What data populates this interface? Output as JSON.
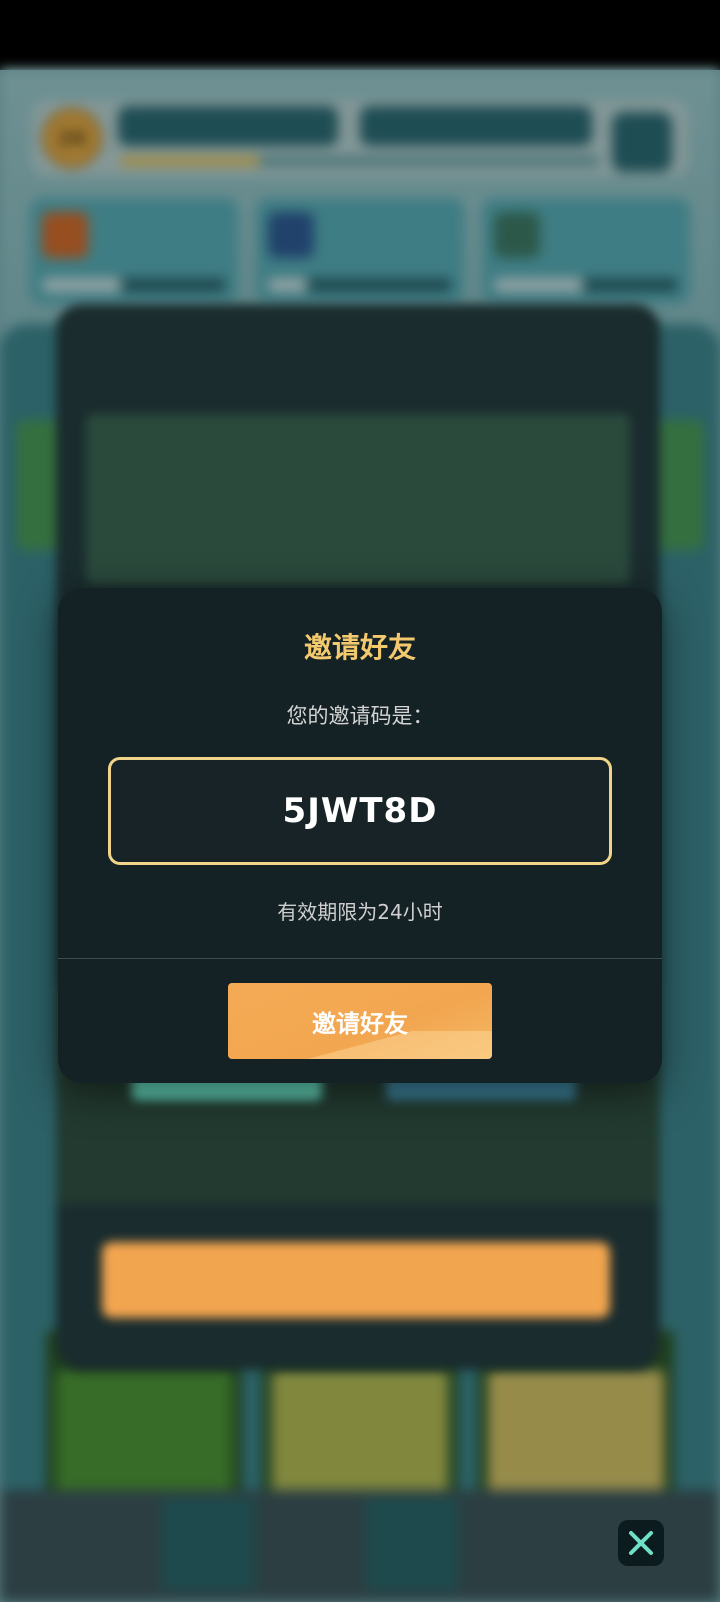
{
  "invite_modal": {
    "title": "邀请好友",
    "prompt": "您的邀请码是：",
    "invite_code": "5JWT8D",
    "validity": "有效期限为24小时",
    "button_label": "邀请好友"
  },
  "background": {
    "player_level": "24"
  },
  "colors": {
    "accent_gold": "#f3c96e",
    "button_orange": "#f2a64f",
    "modal_bg": "#142125",
    "code_border": "#f0d489"
  },
  "icons": [
    "close-icon",
    "gear-icon"
  ]
}
